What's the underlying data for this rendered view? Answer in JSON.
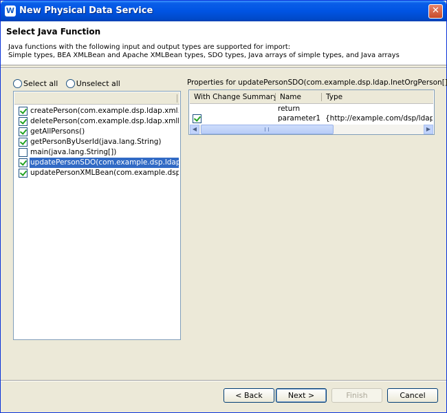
{
  "window": {
    "title": "New Physical Data Service",
    "icon": "W"
  },
  "header": {
    "title": "Select Java Function",
    "description_line1": "Java functions with the following input and output types are supported for import:",
    "description_line2": "Simple types, BEA XMLBean and Apache XMLBean types, SDO types, Java arrays of simple types, and Java arrays"
  },
  "selection": {
    "select_all": "Select all",
    "unselect_all": "Unselect all"
  },
  "functions": [
    {
      "label": "createPerson(com.example.dsp.ldap.xml…",
      "checked": true,
      "selected": false
    },
    {
      "label": "deletePerson(com.example.dsp.ldap.xmlb…",
      "checked": true,
      "selected": false
    },
    {
      "label": "getAllPersons()",
      "checked": true,
      "selected": false
    },
    {
      "label": "getPersonByUserId(java.lang.String)",
      "checked": true,
      "selected": false
    },
    {
      "label": "main(java.lang.String[])",
      "checked": false,
      "selected": false
    },
    {
      "label": "updatePersonSDO(com.example.dsp.ldap…",
      "checked": true,
      "selected": true
    },
    {
      "label": "updatePersonXMLBean(com.example.dsp…",
      "checked": true,
      "selected": false
    }
  ],
  "properties": {
    "label": "Properties for updatePersonSDO(com.example.dsp.ldap.InetOrgPerson[]):",
    "columns": [
      "With Change Summary",
      "Name",
      "Type"
    ],
    "rows": [
      {
        "change_summary": false,
        "name": "return",
        "type": ""
      },
      {
        "change_summary": true,
        "name": "parameter1",
        "type": "{http://example.com/dsp/ldap}ld"
      }
    ]
  },
  "buttons": {
    "back": "< Back",
    "next": "Next >",
    "finish": "Finish",
    "cancel": "Cancel"
  }
}
